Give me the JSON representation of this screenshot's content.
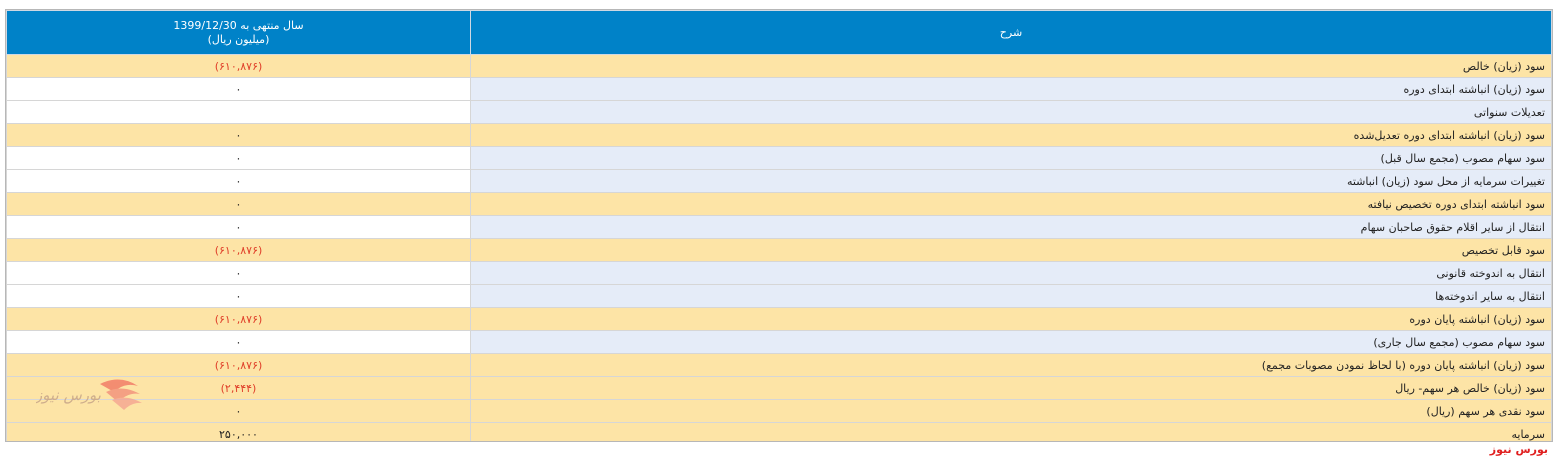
{
  "table": {
    "header": {
      "value_col_line1": "سال منتهی به 1399/12/30",
      "value_col_line2": "(میلیون ریال)",
      "desc_col": "شرح"
    },
    "rows": [
      {
        "label": "سود (زیان) خالص",
        "value": "(۶۱۰,۸۷۶)",
        "negative": true,
        "highlight": true
      },
      {
        "label": "سود (زیان) انباشته ابتدای دوره",
        "value": "۰",
        "negative": false,
        "highlight": false
      },
      {
        "label": "تعدیلات سنواتی",
        "value": "",
        "negative": false,
        "highlight": false
      },
      {
        "label": "سود (زیان) انباشته ابتدای دوره تعدیل‌شده",
        "value": "۰",
        "negative": false,
        "highlight": true
      },
      {
        "label": "سود سهام مصوب (مجمع سال قبل)",
        "value": "۰",
        "negative": false,
        "highlight": false
      },
      {
        "label": "تغییرات سرمایه از محل سود (زیان) انباشته",
        "value": "۰",
        "negative": false,
        "highlight": false
      },
      {
        "label": "سود انباشته ابتدای دوره تخصیص نیافته",
        "value": "۰",
        "negative": false,
        "highlight": true
      },
      {
        "label": "انتقال از سایر اقلام حقوق صاحبان سهام",
        "value": "۰",
        "negative": false,
        "highlight": false
      },
      {
        "label": "سود قابل تخصیص",
        "value": "(۶۱۰,۸۷۶)",
        "negative": true,
        "highlight": true
      },
      {
        "label": "انتقال به اندوخته قانونی",
        "value": "۰",
        "negative": false,
        "highlight": false
      },
      {
        "label": "انتقال به سایر اندوخته‌ها",
        "value": "۰",
        "negative": false,
        "highlight": false
      },
      {
        "label": "سود (زیان) انباشته پایان دوره",
        "value": "(۶۱۰,۸۷۶)",
        "negative": true,
        "highlight": true
      },
      {
        "label": "سود سهام مصوب (مجمع سال جاری)",
        "value": "۰",
        "negative": false,
        "highlight": false
      },
      {
        "label": "سود (زیان) انباشته پایان دوره (با لحاظ نمودن مصوبات مجمع)",
        "value": "(۶۱۰,۸۷۶)",
        "negative": true,
        "highlight": true
      },
      {
        "label": "سود (زیان) خالص هر سهم- ریال",
        "value": "(۲,۴۴۴)",
        "negative": true,
        "highlight": true
      },
      {
        "label": "سود نقدی هر سهم (ریال)",
        "value": "۰",
        "negative": false,
        "highlight": true
      },
      {
        "label": "سرمایه",
        "value": "۲۵۰,۰۰۰",
        "negative": false,
        "highlight": true
      }
    ]
  },
  "brand": {
    "watermark_text": "بورس نیوز",
    "footer_text": "بورس نیوز"
  },
  "colors": {
    "header_bg": "#0082c8",
    "highlight_row": "#fde4a6",
    "desc_cell": "#e5ecf8",
    "negative_text": "#e0402a",
    "brand_red": "#e02020"
  }
}
